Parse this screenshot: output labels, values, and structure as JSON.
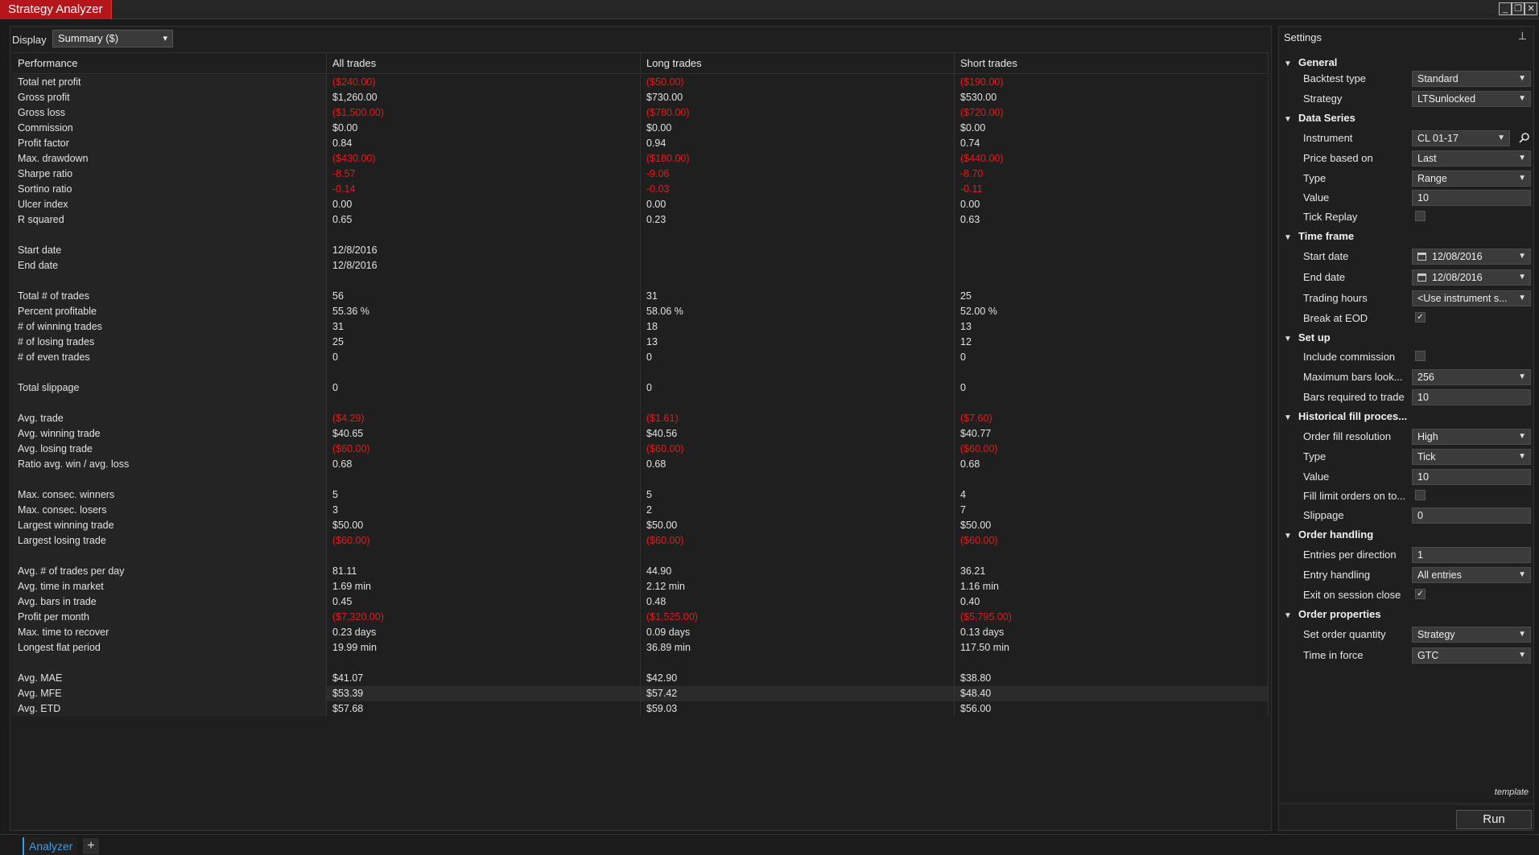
{
  "window": {
    "title": "Strategy Analyzer",
    "buttons": {
      "minimize": "_",
      "restore": "❐",
      "close": "✕"
    }
  },
  "display": {
    "label": "Display",
    "selected": "Summary ($)"
  },
  "table": {
    "headers": [
      "Performance",
      "All trades",
      "Long trades",
      "Short trades"
    ],
    "rows": [
      [
        "Total net profit",
        "($240.00)",
        "($50.00)",
        "($190.00)"
      ],
      [
        "Gross profit",
        "$1,260.00",
        "$730.00",
        "$530.00"
      ],
      [
        "Gross loss",
        "($1,500.00)",
        "($780.00)",
        "($720.00)"
      ],
      [
        "Commission",
        "$0.00",
        "$0.00",
        "$0.00"
      ],
      [
        "Profit factor",
        "0.84",
        "0.94",
        "0.74"
      ],
      [
        "Max. drawdown",
        "($430.00)",
        "($180.00)",
        "($440.00)"
      ],
      [
        "Sharpe ratio",
        "-8.57",
        "-9.06",
        "-8.70"
      ],
      [
        "Sortino ratio",
        "-0.14",
        "-0.03",
        "-0.11"
      ],
      [
        "Ulcer index",
        "0.00",
        "0.00",
        "0.00"
      ],
      [
        "R squared",
        "0.65",
        "0.23",
        "0.63"
      ],
      [
        "",
        "",
        "",
        ""
      ],
      [
        "Start date",
        "12/8/2016",
        "",
        ""
      ],
      [
        "End date",
        "12/8/2016",
        "",
        ""
      ],
      [
        "",
        "",
        "",
        ""
      ],
      [
        "Total # of trades",
        "56",
        "31",
        "25"
      ],
      [
        "Percent profitable",
        "55.36 %",
        "58.06 %",
        "52.00 %"
      ],
      [
        "# of winning trades",
        "31",
        "18",
        "13"
      ],
      [
        "# of losing trades",
        "25",
        "13",
        "12"
      ],
      [
        "# of even trades",
        "0",
        "0",
        "0"
      ],
      [
        "",
        "",
        "",
        ""
      ],
      [
        "Total slippage",
        "0",
        "0",
        "0"
      ],
      [
        "",
        "",
        "",
        ""
      ],
      [
        "Avg. trade",
        "($4.29)",
        "($1.61)",
        "($7.60)"
      ],
      [
        "Avg. winning trade",
        "$40.65",
        "$40.56",
        "$40.77"
      ],
      [
        "Avg. losing trade",
        "($60.00)",
        "($60.00)",
        "($60.00)"
      ],
      [
        "Ratio avg. win / avg. loss",
        "0.68",
        "0.68",
        "0.68"
      ],
      [
        "",
        "",
        "",
        ""
      ],
      [
        "Max. consec. winners",
        "5",
        "5",
        "4"
      ],
      [
        "Max. consec. losers",
        "3",
        "2",
        "7"
      ],
      [
        "Largest winning trade",
        "$50.00",
        "$50.00",
        "$50.00"
      ],
      [
        "Largest losing trade",
        "($60.00)",
        "($60.00)",
        "($60.00)"
      ],
      [
        "",
        "",
        "",
        ""
      ],
      [
        "Avg. # of trades per day",
        "81.11",
        "44.90",
        "36.21"
      ],
      [
        "Avg. time in market",
        "1.69 min",
        "2.12 min",
        "1.16 min"
      ],
      [
        "Avg. bars in trade",
        "0.45",
        "0.48",
        "0.40"
      ],
      [
        "Profit per month",
        "($7,320.00)",
        "($1,525.00)",
        "($5,795.00)"
      ],
      [
        "Max. time to recover",
        "0.23 days",
        "0.09 days",
        "0.13 days"
      ],
      [
        "Longest flat period",
        "19.99 min",
        "36.89 min",
        "117.50 min"
      ],
      [
        "",
        "",
        "",
        ""
      ],
      [
        "Avg. MAE",
        "$41.07",
        "$42.90",
        "$38.80"
      ],
      [
        "Avg. MFE",
        "$53.39",
        "$57.42",
        "$48.40"
      ],
      [
        "Avg. ETD",
        "$57.68",
        "$59.03",
        "$56.00"
      ]
    ]
  },
  "settings": {
    "title": "Settings",
    "pin_icon": "pin-icon",
    "sections": {
      "general": "General",
      "data_series": "Data Series",
      "time_frame": "Time frame",
      "set_up": "Set up",
      "historical_fill": "Historical fill proces...",
      "order_handling": "Order handling",
      "order_properties": "Order properties"
    },
    "fields": {
      "backtest_type": {
        "label": "Backtest type",
        "value": "Standard"
      },
      "strategy": {
        "label": "Strategy",
        "value": "LTSunlocked"
      },
      "instrument": {
        "label": "Instrument",
        "value": "CL 01-17"
      },
      "price_based_on": {
        "label": "Price based on",
        "value": "Last"
      },
      "ds_type": {
        "label": "Type",
        "value": "Range"
      },
      "ds_value": {
        "label": "Value",
        "value": "10"
      },
      "tick_replay": {
        "label": "Tick Replay"
      },
      "start_date": {
        "label": "Start date",
        "value": "12/08/2016"
      },
      "end_date": {
        "label": "End date",
        "value": "12/08/2016"
      },
      "trading_hours": {
        "label": "Trading hours",
        "value": "<Use instrument s..."
      },
      "break_at_eod": {
        "label": "Break at EOD",
        "check": "✓"
      },
      "include_commission": {
        "label": "Include commission"
      },
      "max_bars_lookback": {
        "label": "Maximum bars look...",
        "value": "256"
      },
      "bars_required": {
        "label": "Bars required to trade",
        "value": "10"
      },
      "order_fill_resolution": {
        "label": "Order fill resolution",
        "value": "High"
      },
      "fill_type": {
        "label": "Type",
        "value": "Tick"
      },
      "fill_value": {
        "label": "Value",
        "value": "10"
      },
      "fill_limit_orders": {
        "label": "Fill limit orders on to..."
      },
      "slippage": {
        "label": "Slippage",
        "value": "0"
      },
      "entries_per_direction": {
        "label": "Entries per direction",
        "value": "1"
      },
      "entry_handling": {
        "label": "Entry handling",
        "value": "All entries"
      },
      "exit_on_session_close": {
        "label": "Exit on session close",
        "check": "✓"
      },
      "set_order_quantity": {
        "label": "Set order quantity",
        "value": "Strategy"
      },
      "time_in_force": {
        "label": "Time in force",
        "value": "GTC"
      }
    },
    "template_label": "template",
    "run_label": "Run"
  },
  "tabs": {
    "active": "Analyzer",
    "add": "+"
  },
  "colors": {
    "negative": "#e21b1b",
    "title_bg": "#b5161c",
    "tab_accent": "#3c9be8"
  }
}
